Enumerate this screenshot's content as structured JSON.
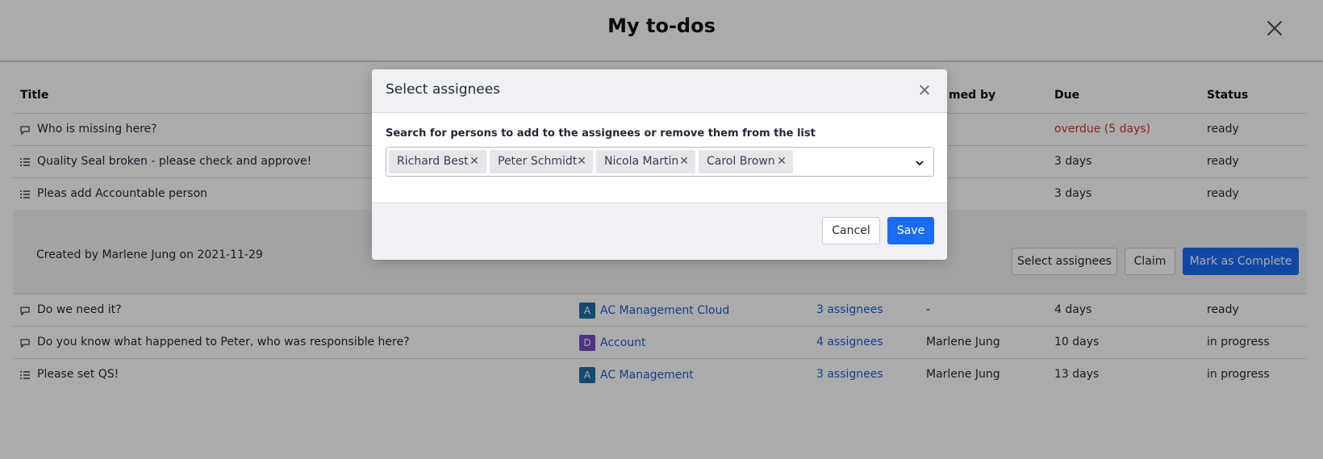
{
  "page": {
    "title": "My to-dos"
  },
  "table": {
    "headers": {
      "title": "Title",
      "claimed_by": "med by",
      "due": "Due",
      "status": "Status"
    },
    "rows_top": [
      {
        "icon": "comment-icon",
        "title": "Who is missing here?",
        "due": "overdue (5 days)",
        "status": "ready"
      },
      {
        "icon": "checklist-icon",
        "title": "Quality Seal broken - please check and approve!",
        "due": "3 days",
        "status": "ready"
      },
      {
        "icon": "checklist-icon",
        "title": "Pleas add Accountable person",
        "due": "3 days",
        "status": "ready"
      }
    ],
    "expanded": {
      "created_text": "Created by Marlene Jung on 2021-11-29",
      "select_assignees": "Select assignees",
      "claim": "Claim",
      "mark_complete": "Mark as Complete"
    },
    "rows_bottom": [
      {
        "icon": "comment-icon",
        "title": "Do we need it?",
        "badge": "A",
        "module": "AC Management Cloud",
        "assignees": "3 assignees",
        "claimed_by": "-",
        "due": "4 days",
        "status": "ready"
      },
      {
        "icon": "comment-icon",
        "title": "Do you know what happened to Peter, who was responsible here?",
        "badge": "D",
        "module": "Account",
        "assignees": "4 assignees",
        "claimed_by": "Marlene Jung",
        "due": "10 days",
        "status": "in progress"
      },
      {
        "icon": "checklist-icon",
        "title": "Please set QS!",
        "badge": "A",
        "module": "AC Management",
        "assignees": "3 assignees",
        "claimed_by": "Marlene Jung",
        "due": "13 days",
        "status": "in progress"
      }
    ]
  },
  "modal": {
    "title": "Select assignees",
    "label": "Search for persons to add to the assignees or remove them from the list",
    "chips": [
      "Richard Best",
      "Peter Schmidt",
      "Nicola Martin",
      "Carol Brown"
    ],
    "cancel": "Cancel",
    "save": "Save"
  },
  "colors": {
    "primary": "#1a6cf5",
    "link": "#1f5fd1",
    "overdue": "#d9342b",
    "badge_a": "#1f6fa3",
    "badge_d": "#7a4bc2"
  }
}
